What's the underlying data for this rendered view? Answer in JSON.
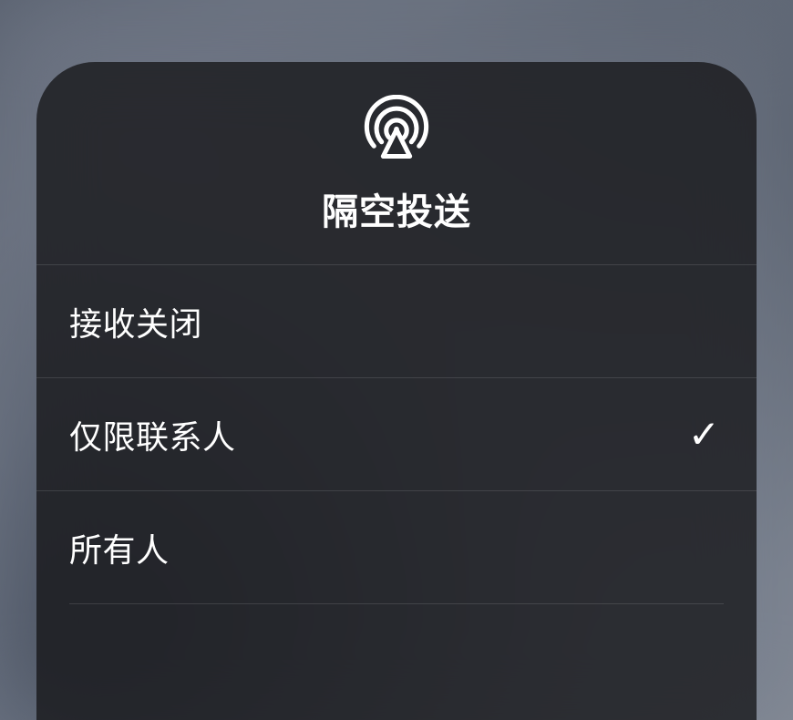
{
  "panel": {
    "title": "隔空投送",
    "icon": "airdrop-icon"
  },
  "options": [
    {
      "label": "接收关闭",
      "selected": false
    },
    {
      "label": "仅限联系人",
      "selected": true
    },
    {
      "label": "所有人",
      "selected": false
    }
  ]
}
